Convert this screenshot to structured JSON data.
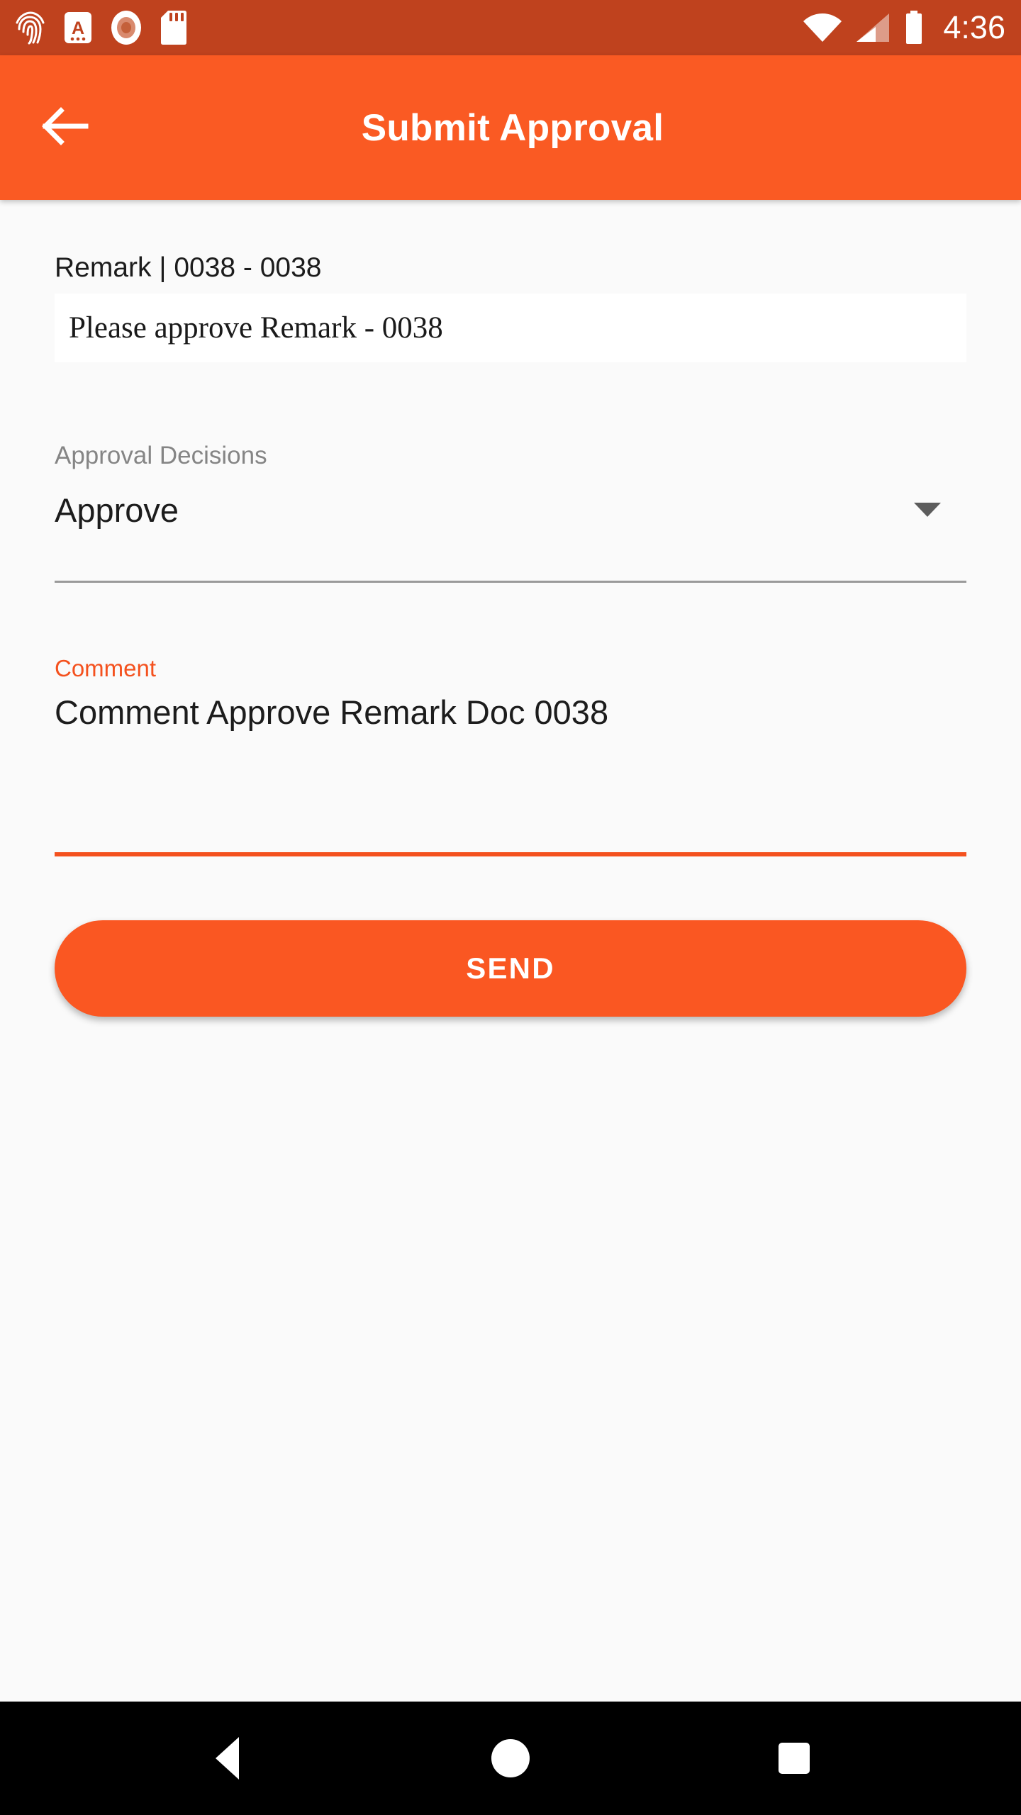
{
  "status_bar": {
    "background_color": "#bf421e",
    "clock": "4:36",
    "left_icons": [
      {
        "name": "fingerprint-icon"
      },
      {
        "name": "letter-a-badge-icon"
      },
      {
        "name": "record-circle-icon"
      },
      {
        "name": "sd-card-icon"
      }
    ],
    "right_icons": [
      {
        "name": "wifi-icon"
      },
      {
        "name": "cellular-signal-icon"
      },
      {
        "name": "battery-icon"
      }
    ]
  },
  "app_bar": {
    "background_color": "#fa5a23",
    "title": "Submit Approval",
    "back_icon": "arrow-left-icon"
  },
  "form": {
    "remark": {
      "label": "Remark | 0038 - 0038",
      "value": "Please approve Remark - 0038"
    },
    "approval_decisions": {
      "label": "Approval Decisions",
      "value": "Approve",
      "caret_icon": "chevron-down-icon",
      "options": [
        "Approve"
      ]
    },
    "comment": {
      "label": "Comment",
      "value": "Comment Approve Remark Doc 0038",
      "accent_color": "#f4511e"
    },
    "send_button": {
      "label": "SEND",
      "background_color": "#fa5722"
    }
  },
  "nav_bar": {
    "background_color": "#000000",
    "buttons": [
      {
        "name": "nav-back",
        "icon": "triangle-left-icon"
      },
      {
        "name": "nav-home",
        "icon": "circle-icon"
      },
      {
        "name": "nav-recents",
        "icon": "square-icon"
      }
    ]
  }
}
